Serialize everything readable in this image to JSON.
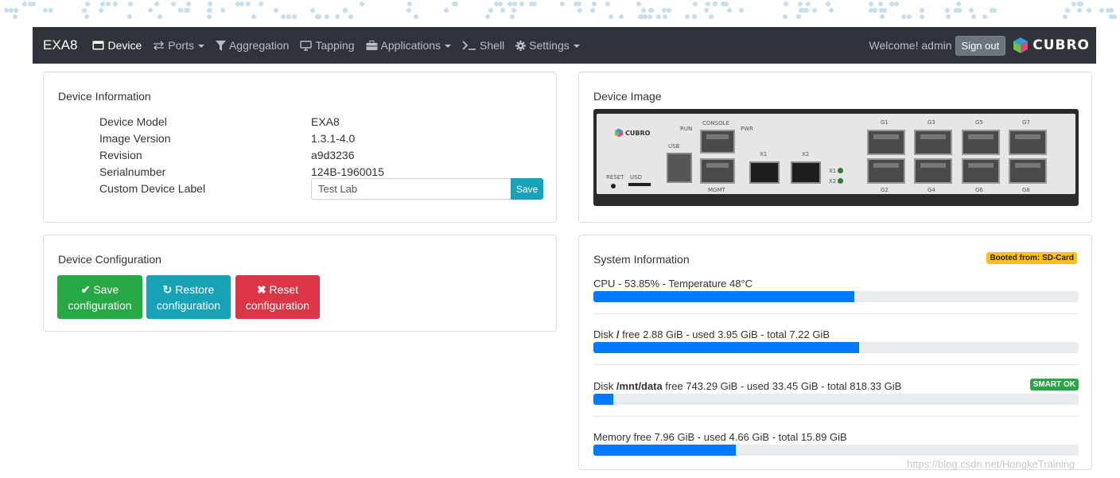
{
  "navbar": {
    "brand": "EXA8",
    "items": [
      {
        "label": "Device",
        "icon": "device-icon",
        "active": true,
        "dropdown": false
      },
      {
        "label": "Ports",
        "icon": "swap-arrows-icon",
        "active": false,
        "dropdown": true
      },
      {
        "label": "Aggregation",
        "icon": "filter-icon",
        "active": false,
        "dropdown": false
      },
      {
        "label": "Tapping",
        "icon": "monitor-icon",
        "active": false,
        "dropdown": false
      },
      {
        "label": "Applications",
        "icon": "briefcase-icon",
        "active": false,
        "dropdown": true
      },
      {
        "label": "Shell",
        "icon": "terminal-icon",
        "active": false,
        "dropdown": false
      },
      {
        "label": "Settings",
        "icon": "gear-icon",
        "active": false,
        "dropdown": true
      }
    ],
    "welcome": "Welcome! admin",
    "signout_label": "Sign out",
    "logo_text": "CUBRO"
  },
  "device_info": {
    "title": "Device Information",
    "rows": [
      {
        "label": "Device Model",
        "value": "EXA8"
      },
      {
        "label": "Image Version",
        "value": "1.3.1-4.0"
      },
      {
        "label": "Revision",
        "value": "a9d3236"
      },
      {
        "label": "Serialnumber",
        "value": "124B-1960015"
      },
      {
        "label": "Custom Device Label",
        "value": ""
      }
    ],
    "label_input_value": "Test Lab",
    "save_label": "Save"
  },
  "device_config": {
    "title": "Device Configuration",
    "save": {
      "line1": "Save",
      "line2": "configuration"
    },
    "restore": {
      "line1": "Restore",
      "line2": "configuration"
    },
    "reset": {
      "line1": "Reset",
      "line2": "configuration"
    }
  },
  "device_image": {
    "title": "Device Image",
    "labels": {
      "brand": "CUBRO",
      "run": "RUN",
      "console": "CONSOLE",
      "pwr": "PWR",
      "usb": "USB",
      "reset": "RESET",
      "usd": "USD",
      "mgmt": "MGMT",
      "x1": "X1",
      "x2": "X2",
      "g1": "G1",
      "g2": "G2",
      "g3": "G3",
      "g4": "G4",
      "g5": "G5",
      "g6": "G6",
      "g7": "G7",
      "g8": "G8"
    }
  },
  "system_info": {
    "title": "System Information",
    "boot_badge": "Booted from: SD-Card",
    "smart_badge": "SMART OK",
    "cpu": {
      "text": "CPU - 53.85% - Temperature 48°C",
      "percent": 53.85
    },
    "disk_root": {
      "prefix": "Disk ",
      "mount": "/",
      "rest": " free 2.88 GiB - used 3.95 GiB - total 7.22 GiB",
      "percent": 54.7
    },
    "disk_data": {
      "prefix": "Disk ",
      "mount": "/mnt/data",
      "rest": " free 743.29 GiB - used 33.45 GiB - total 818.33 GiB",
      "percent": 4.1
    },
    "memory": {
      "text": "Memory free 7.96 GiB - used 4.66 GiB - total 15.89 GiB",
      "percent": 29.3
    }
  },
  "watermark": "https://blog.csdn.net/HongkeTraining",
  "colors": {
    "navbar": "#30343a",
    "green": "#28a745",
    "teal": "#17a2b8",
    "red": "#dc3545",
    "progress": "#007bff",
    "warning": "#ffc107"
  }
}
